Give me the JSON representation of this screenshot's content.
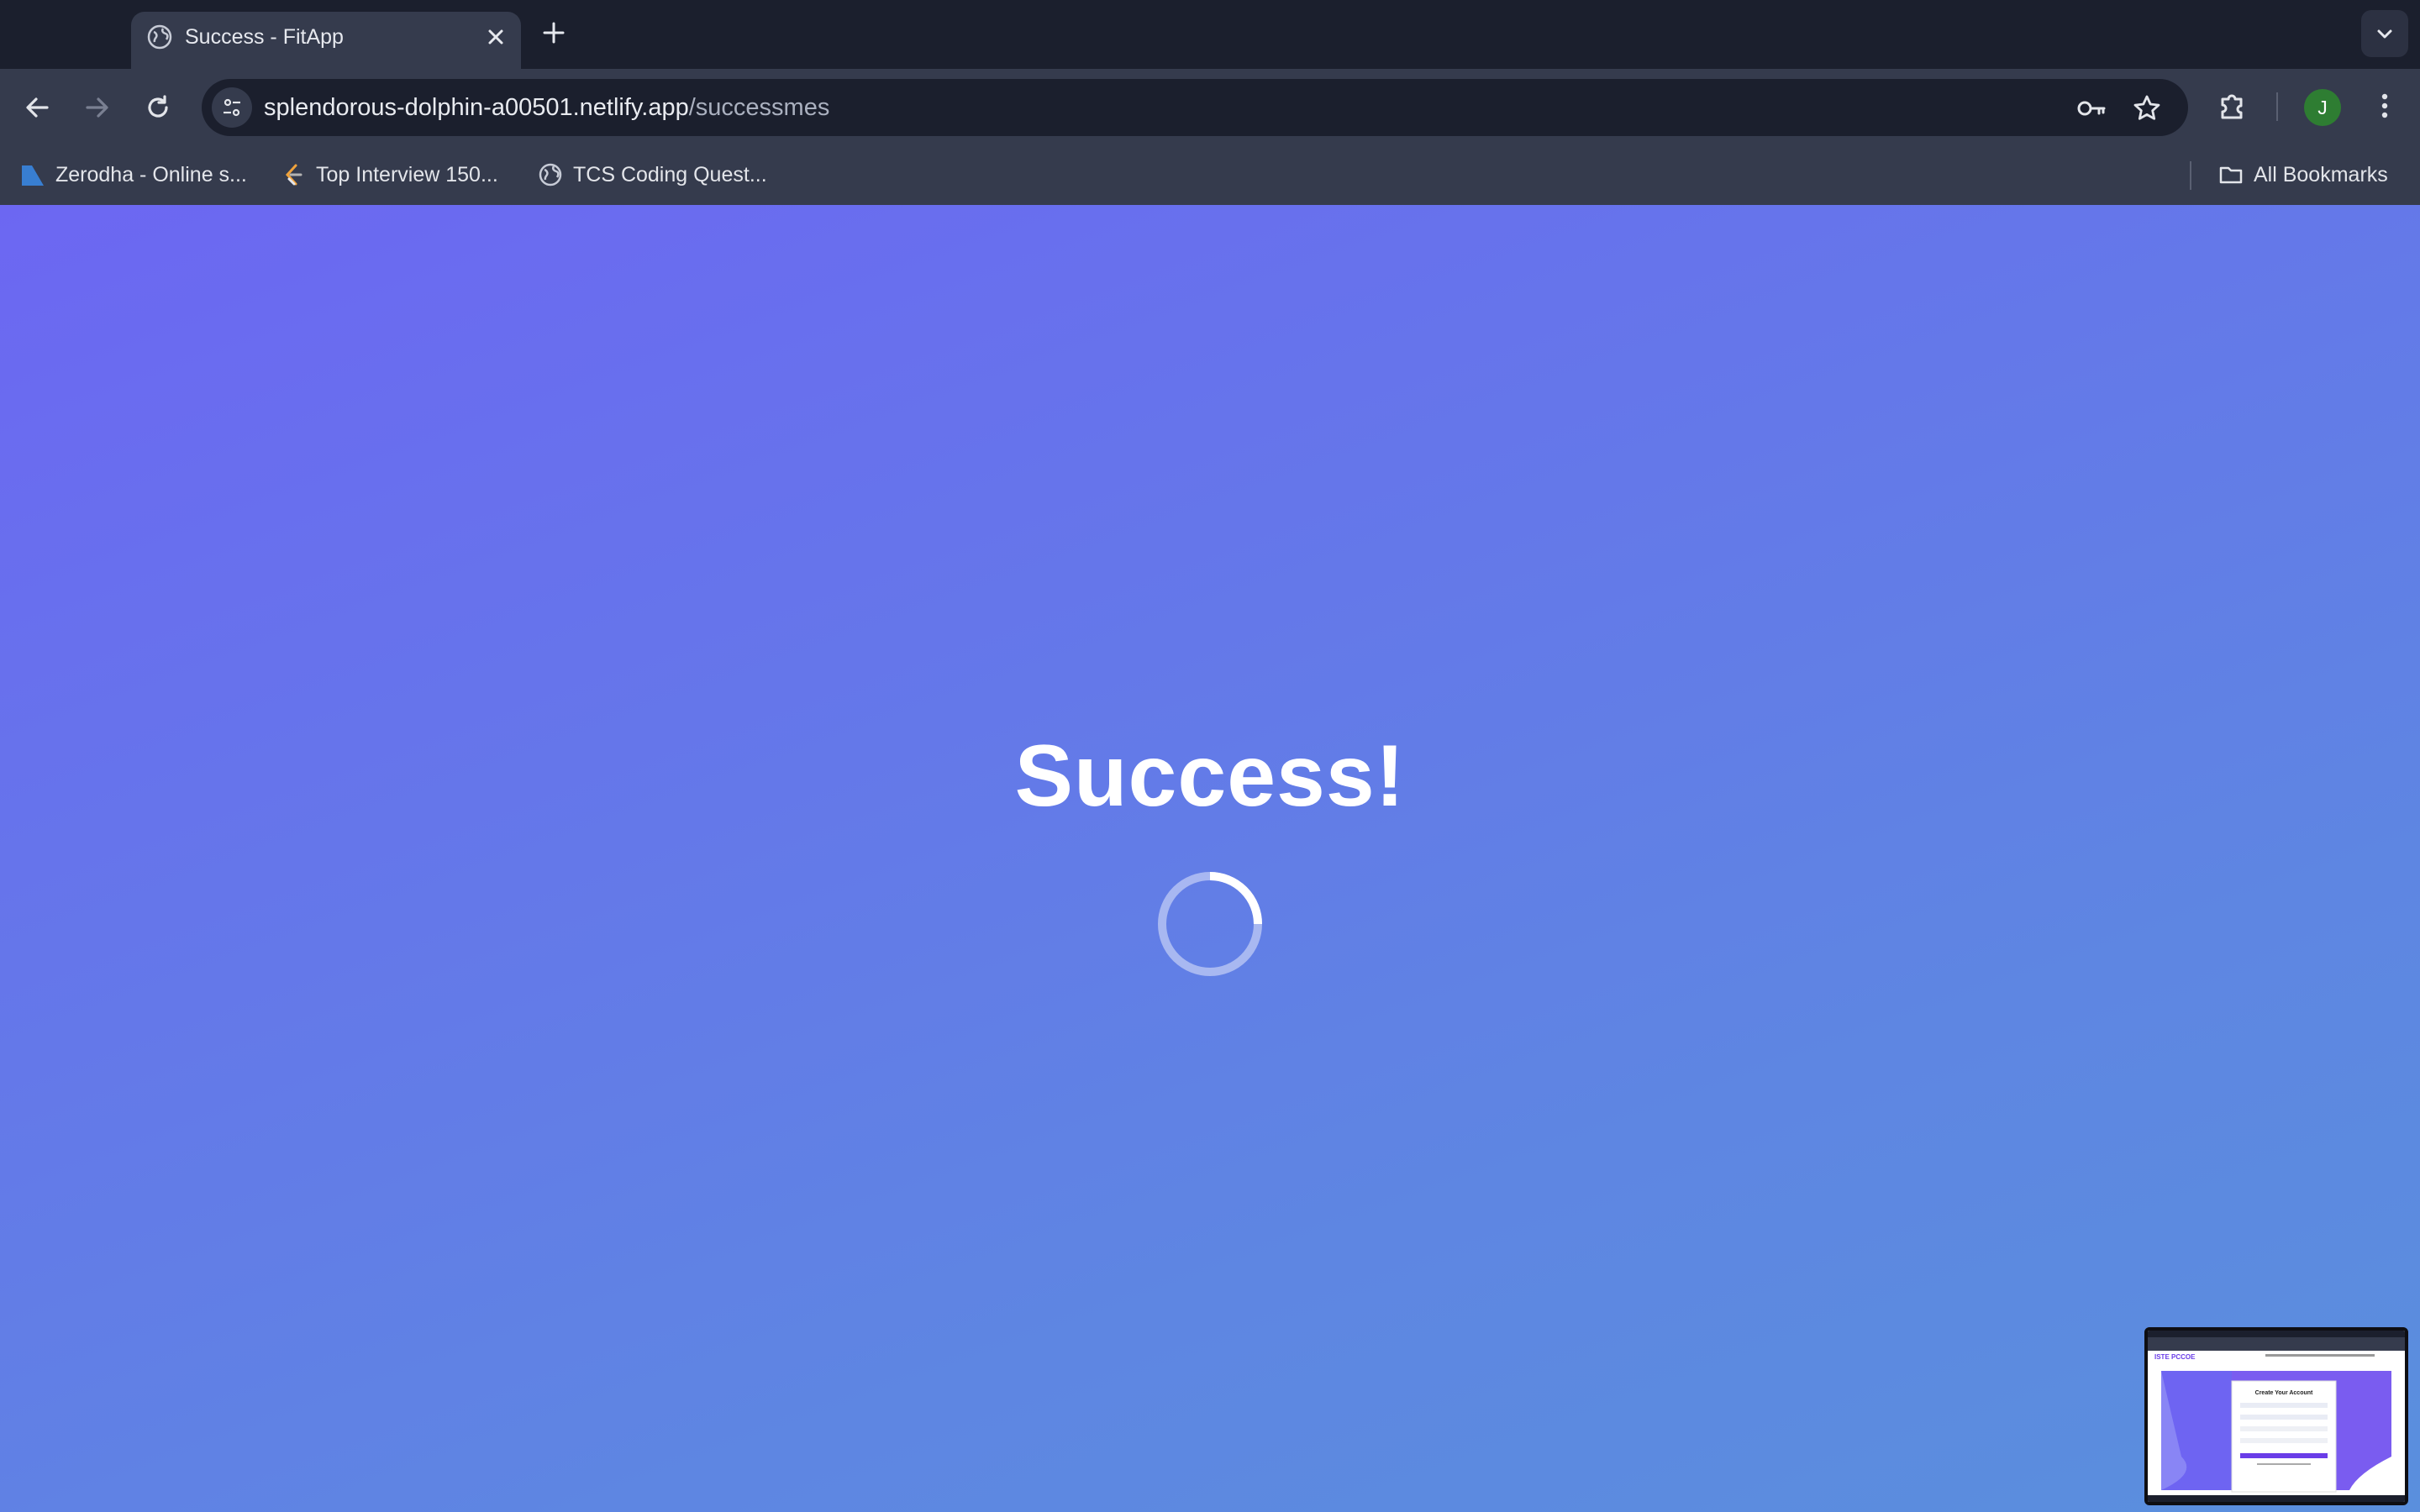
{
  "browser": {
    "tab": {
      "title": "Success - FitApp"
    },
    "url": {
      "host": "splendorous-dolphin-a00501.netlify.app",
      "path": "/successmes"
    },
    "profile_initial": "J",
    "bookmarks": [
      {
        "label": "Zerodha - Online s..."
      },
      {
        "label": "Top Interview 150..."
      },
      {
        "label": "TCS Coding Quest..."
      }
    ],
    "all_bookmarks_label": "All Bookmarks"
  },
  "page": {
    "headline": "Success!",
    "spinner_state": "loading"
  },
  "colors": {
    "gradient_start": "#6c67f2",
    "gradient_end": "#5a8fdd",
    "chrome_dark": "#1b1f2d",
    "chrome_toolbar": "#353b4d"
  },
  "thumbnail": {
    "brand": "ISTE PCCOE",
    "heading": "Create Your Account"
  }
}
